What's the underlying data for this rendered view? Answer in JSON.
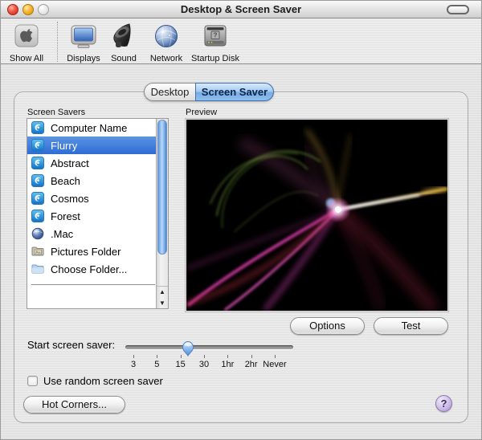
{
  "window": {
    "title": "Desktop & Screen Saver",
    "traffic_lights": [
      "close",
      "minimize",
      "zoom-disabled"
    ]
  },
  "toolbar": {
    "show_all_label": "Show All",
    "items": [
      {
        "label": "Displays",
        "icon": "display-icon"
      },
      {
        "label": "Sound",
        "icon": "speaker-icon"
      },
      {
        "label": "Network",
        "icon": "globe-icon"
      },
      {
        "label": "Startup Disk",
        "icon": "disk-icon"
      }
    ]
  },
  "tabs": {
    "items": [
      {
        "label": "Desktop",
        "selected": false
      },
      {
        "label": "Screen Saver",
        "selected": true
      }
    ]
  },
  "panel": {
    "list_label": "Screen Savers",
    "preview_label": "Preview",
    "list_items": [
      {
        "label": "Computer Name",
        "icon": "swirl",
        "selected": false
      },
      {
        "label": "Flurry",
        "icon": "swirl",
        "selected": true
      },
      {
        "label": "Abstract",
        "icon": "swirl",
        "selected": false
      },
      {
        "label": "Beach",
        "icon": "swirl",
        "selected": false
      },
      {
        "label": "Cosmos",
        "icon": "swirl",
        "selected": false
      },
      {
        "label": "Forest",
        "icon": "swirl",
        "selected": false
      },
      {
        "label": ".Mac",
        "icon": "mac-globe",
        "selected": false
      },
      {
        "label": "Pictures Folder",
        "icon": "pictures-folder",
        "selected": false
      },
      {
        "label": "Choose Folder...",
        "icon": "folder",
        "selected": false
      }
    ],
    "options_button": "Options",
    "test_button": "Test",
    "slider": {
      "label": "Start screen saver:",
      "ticks": [
        "3",
        "5",
        "15",
        "30",
        "1hr",
        "2hr",
        "Never"
      ],
      "thumb_fraction": 0.373
    },
    "random_checkbox": {
      "label": "Use random screen saver",
      "checked": false
    },
    "hot_corners_button": "Hot Corners...",
    "help_button": "?"
  },
  "colors": {
    "selection_blue": "#3875d7",
    "tab_blue": "#78abe4",
    "scrollbar_blue": "#7fb2ea",
    "help_purple": "#cdbce8",
    "preview_background": "#000000"
  }
}
